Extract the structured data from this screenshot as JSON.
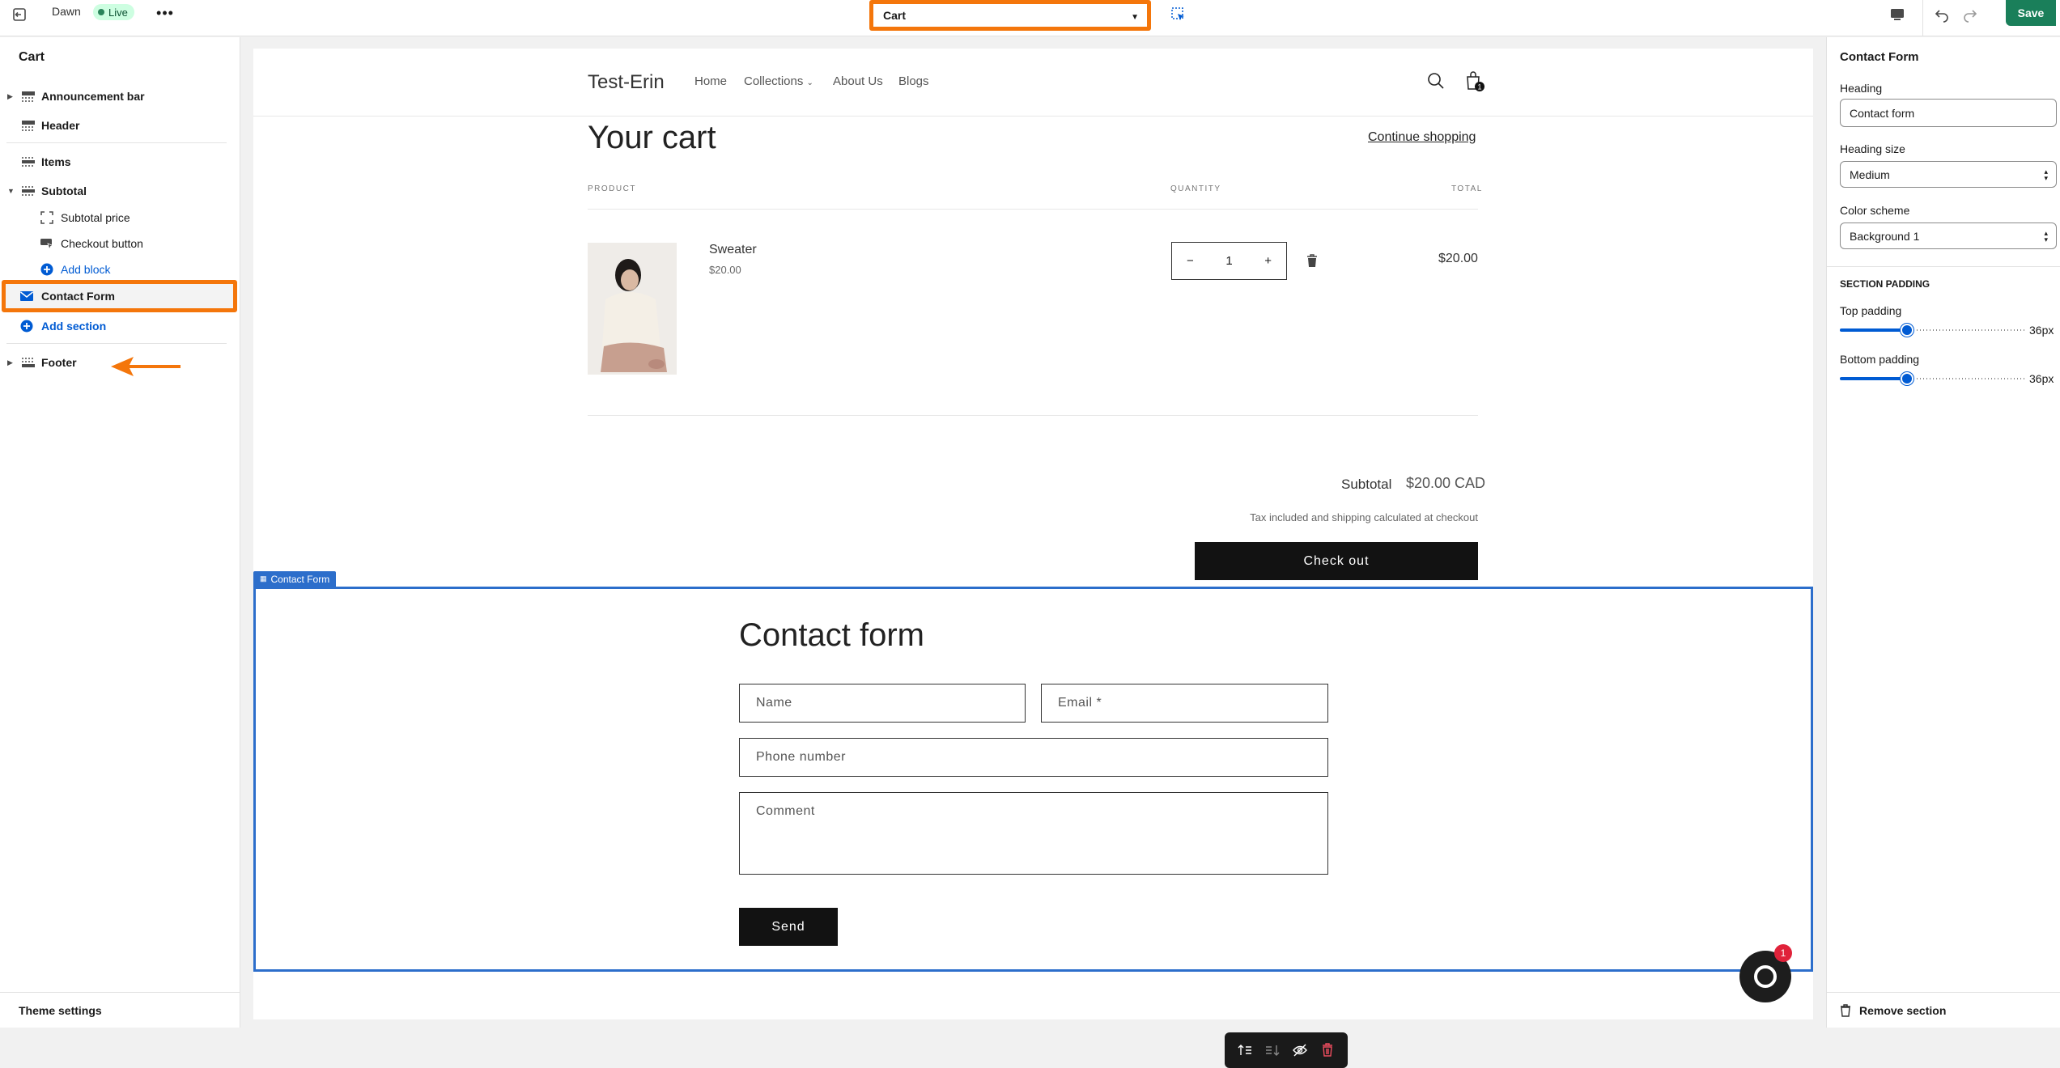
{
  "topbar": {
    "theme_name": "Dawn",
    "status_badge": "Live",
    "template_selected": "Cart",
    "save_label": "Save"
  },
  "sidebar": {
    "title": "Cart",
    "items": [
      {
        "label": "Announcement bar"
      },
      {
        "label": "Header"
      },
      {
        "label": "Items"
      },
      {
        "label": "Subtotal"
      },
      {
        "label": "Subtotal price"
      },
      {
        "label": "Checkout button"
      },
      {
        "label": "Add block"
      },
      {
        "label": "Contact Form"
      },
      {
        "label": "Add section"
      },
      {
        "label": "Footer"
      }
    ],
    "footer_label": "Theme settings"
  },
  "preview": {
    "store_name": "Test-Erin",
    "nav": [
      "Home",
      "Collections",
      "About Us",
      "Blogs"
    ],
    "cart_count": "1",
    "cart_title": "Your cart",
    "continue_shopping": "Continue shopping",
    "columns": {
      "product": "PRODUCT",
      "quantity": "QUANTITY",
      "total": "TOTAL"
    },
    "product": {
      "name": "Sweater",
      "price": "$20.00",
      "quantity": "1",
      "line_total": "$20.00"
    },
    "subtotal_label": "Subtotal",
    "subtotal_value": "$20.00 CAD",
    "tax_note": "Tax included and shipping calculated at checkout",
    "checkout_label": "Check out",
    "section_tag": "Contact Form",
    "contact": {
      "title": "Contact form",
      "name_placeholder": "Name",
      "email_placeholder": "Email *",
      "phone_placeholder": "Phone number",
      "comment_placeholder": "Comment",
      "send_label": "Send"
    },
    "chat_badge": "1"
  },
  "rpanel": {
    "title": "Contact Form",
    "heading_label": "Heading",
    "heading_value": "Contact form",
    "heading_size_label": "Heading size",
    "heading_size_value": "Medium",
    "color_scheme_label": "Color scheme",
    "color_scheme_value": "Background 1",
    "section_padding_heading": "SECTION PADDING",
    "top_padding_label": "Top padding",
    "top_padding_value": "36px",
    "top_padding_fraction": 0.36,
    "bottom_padding_label": "Bottom padding",
    "bottom_padding_value": "36px",
    "bottom_padding_fraction": 0.36,
    "remove_label": "Remove section"
  },
  "colors": {
    "accent_blue": "#005bd3",
    "highlight_orange": "#f4760b",
    "save_green": "#1a7f5a",
    "live_badge_bg": "#cdfee1"
  }
}
